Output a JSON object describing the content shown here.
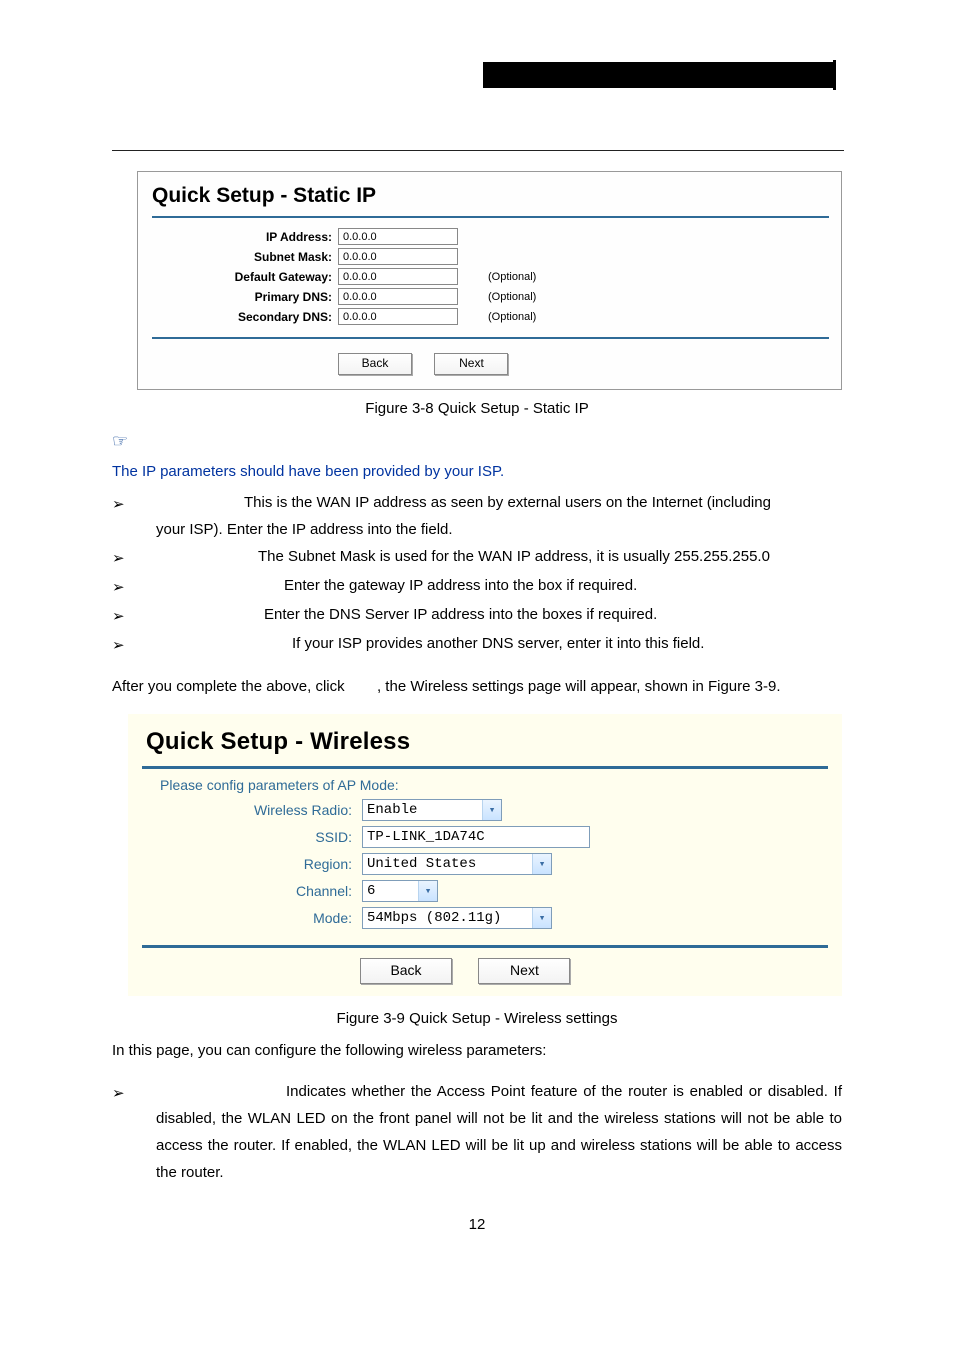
{
  "header_black_bar": true,
  "panel1": {
    "title": "Quick Setup - Static IP",
    "rows": {
      "ip_label": "IP Address:",
      "ip_value": "0.0.0.0",
      "mask_label": "Subnet Mask:",
      "mask_value": "0.0.0.0",
      "gw_label": "Default Gateway:",
      "gw_value": "0.0.0.0",
      "gw_opt": "(Optional)",
      "pdns_label": "Primary DNS:",
      "pdns_value": "0.0.0.0",
      "pdns_opt": "(Optional)",
      "sdns_label": "Secondary DNS:",
      "sdns_value": "0.0.0.0",
      "sdns_opt": "(Optional)"
    },
    "buttons": {
      "back": "Back",
      "next": "Next"
    },
    "caption": "Figure 3-8    Quick Setup - Static IP"
  },
  "hand_glyph": "☞",
  "note_text": "The IP parameters should have been provided by your ISP.",
  "bullets": [
    {
      "marker": "➢",
      "text": "This is the WAN IP address as seen by external users on the Internet (including your ISP). Enter the IP address into the field."
    },
    {
      "marker": "➢",
      "text": "The Subnet Mask is used for the WAN IP address, it is usually 255.255.255.0"
    },
    {
      "marker": "➢",
      "text": "Enter the gateway IP address into the box if required."
    },
    {
      "marker": "➢",
      "text": "Enter the DNS Server IP address into the boxes if required."
    },
    {
      "marker": "➢",
      "text": "If your ISP provides another DNS server, enter it into this field."
    }
  ],
  "mid_para": {
    "a": "After you complete the above, click ",
    "b": ", the Wireless settings page will appear, shown in Figure 3-9."
  },
  "panel2": {
    "title": "Quick Setup - Wireless",
    "subnote": "Please config parameters of AP Mode:",
    "rows": {
      "radio_label": "Wireless Radio:",
      "radio_value": "Enable",
      "ssid_label": "SSID:",
      "ssid_value": "TP-LINK_1DA74C",
      "region_label": "Region:",
      "region_value": "United States",
      "channel_label": "Channel:",
      "channel_value": "6",
      "mode_label": "Mode:",
      "mode_value": "54Mbps (802.11g)"
    },
    "buttons": {
      "back": "Back",
      "next": "Next"
    },
    "caption": "Figure 3-9    Quick Setup - Wireless settings"
  },
  "after_panel2": "In this page, you can configure the following wireless parameters:",
  "bullets2": [
    {
      "marker": "➢",
      "text": "Indicates whether the Access Point feature of the router is enabled or disabled. If disabled, the WLAN LED on the front panel will not be lit and the wireless stations will not be able to access the router. If enabled, the WLAN LED will be lit up and wireless stations will be able to access the router."
    }
  ],
  "page_number": "12"
}
